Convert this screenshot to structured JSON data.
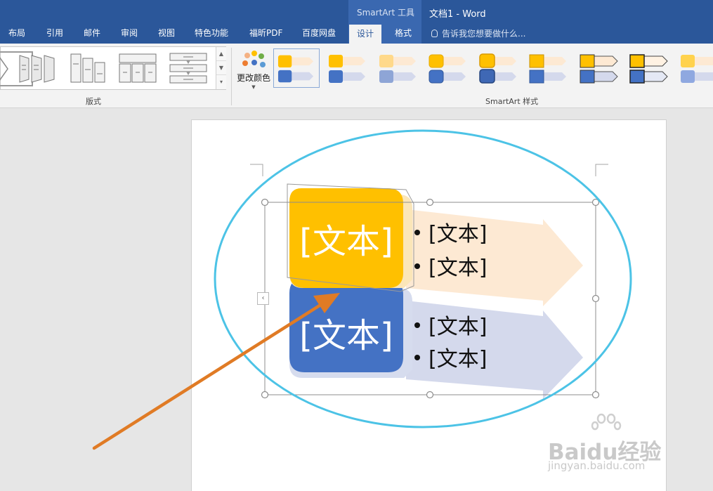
{
  "title_bar": {
    "context_group_title": "SmartArt 工具",
    "document_title": "文档1 - Word"
  },
  "tabs": [
    {
      "label": "布局"
    },
    {
      "label": "引用"
    },
    {
      "label": "邮件"
    },
    {
      "label": "审阅"
    },
    {
      "label": "视图"
    },
    {
      "label": "特色功能"
    },
    {
      "label": "福昕PDF"
    },
    {
      "label": "百度网盘"
    },
    {
      "label": "设计",
      "active": true
    },
    {
      "label": "格式"
    }
  ],
  "tell_me": {
    "text": "告诉我您想要做什么...",
    "icon": "lightbulb-icon"
  },
  "ribbon": {
    "layouts_group_label": "版式",
    "styles_group_label": "SmartArt 样式",
    "change_colors_label": "更改颜色",
    "change_colors_icon": "color-palette-icon"
  },
  "smartart": {
    "cards": [
      {
        "label": "[文本]",
        "color": "#ffc000",
        "bullets": [
          "[文本]",
          "[文本]"
        ],
        "arrow_color": "#fde9d3"
      },
      {
        "label": "[文本]",
        "color": "#4472c4",
        "bullets": [
          "[文本]",
          "[文本]"
        ],
        "arrow_color": "#d4d9ec"
      }
    ]
  },
  "annotations": {
    "ellipse_color": "#4cc3e6",
    "arrow_color": "#e07b25"
  },
  "watermark": {
    "main": "Baidu经验",
    "sub": "jingyan.baidu.com"
  },
  "colors": {
    "title_bar": "#2b579a",
    "ribbon": "#f3f3f3",
    "canvas": "#e6e6e6"
  }
}
